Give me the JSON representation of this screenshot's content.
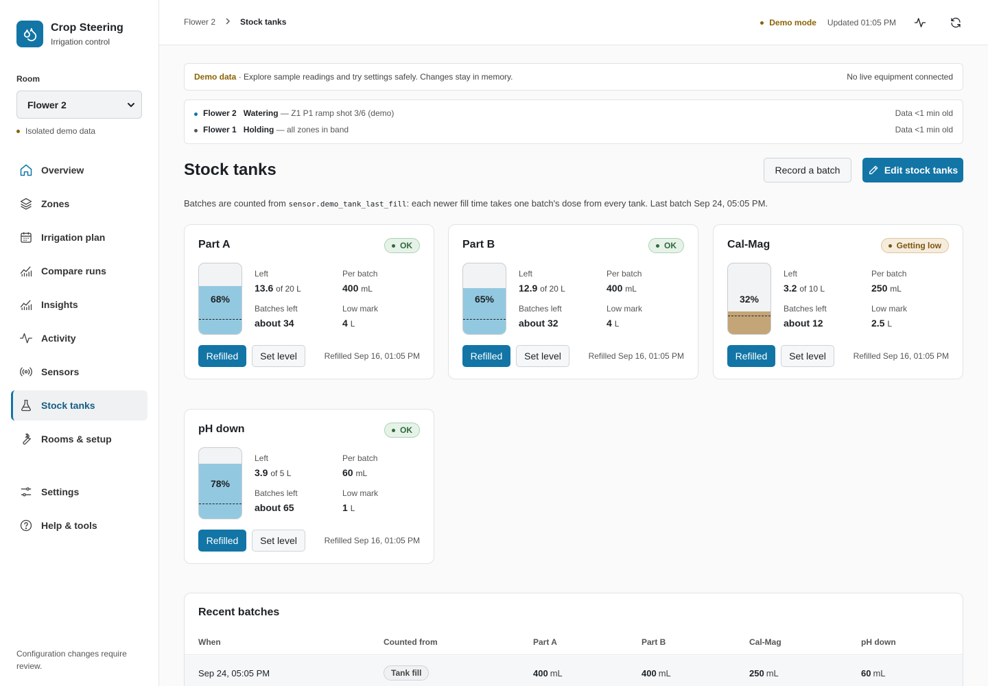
{
  "app": {
    "title": "Crop Steering",
    "subtitle": "Irrigation control"
  },
  "sidebar": {
    "room_label": "Room",
    "room_value": "Flower 2",
    "demo_note": "Isolated demo data",
    "items": [
      {
        "label": "Overview",
        "icon": "home-icon"
      },
      {
        "label": "Zones",
        "icon": "layers-icon"
      },
      {
        "label": "Irrigation plan",
        "icon": "calendar-icon"
      },
      {
        "label": "Compare runs",
        "icon": "chart-icon"
      },
      {
        "label": "Insights",
        "icon": "chart-icon"
      },
      {
        "label": "Activity",
        "icon": "pulse-icon"
      },
      {
        "label": "Sensors",
        "icon": "signal-icon"
      },
      {
        "label": "Stock tanks",
        "icon": "flask-icon"
      },
      {
        "label": "Rooms & setup",
        "icon": "wrench-icon"
      },
      {
        "label": "Settings",
        "icon": "sliders-icon"
      },
      {
        "label": "Help & tools",
        "icon": "help-icon"
      }
    ],
    "footer": "Configuration changes require review."
  },
  "topbar": {
    "breadcrumb": [
      "Flower 2",
      "Stock tanks"
    ],
    "demo_mode": "Demo mode",
    "updated": "Updated 01:05 PM"
  },
  "banner": {
    "bold": "Demo data",
    "text": " · Explore sample readings and try settings safely. Changes stay in memory.",
    "right": "No live equipment connected"
  },
  "status": [
    {
      "room": "Flower 2",
      "state": "Watering",
      "detail": " — Z1 P1 ramp shot 3/6 (demo)",
      "age": "Data <1 min old",
      "color": "#1275a6"
    },
    {
      "room": "Flower 1",
      "state": "Holding",
      "detail": " — all zones in band",
      "age": "Data <1 min old",
      "color": "#555555"
    }
  ],
  "page": {
    "title": "Stock tanks",
    "record_label": "Record a batch",
    "edit_label": "Edit stock tanks",
    "desc_pre": "Batches are counted from ",
    "desc_code": "sensor.demo_tank_last_fill",
    "desc_post": ": each newer fill time takes one batch's dose from every tank. Last batch Sep 24, 05:05 PM."
  },
  "labels": {
    "left": "Left",
    "per_batch": "Per batch",
    "batches_left": "Batches left",
    "low_mark": "Low mark",
    "refilled_btn": "Refilled",
    "set_level_btn": "Set level"
  },
  "tanks": [
    {
      "name": "Part A",
      "status": "OK",
      "pct_label": "68%",
      "fill": 0.68,
      "low": 0.2,
      "left": "13.6",
      "cap": "of 20 L",
      "per_batch": "400",
      "per_unit": "mL",
      "batches_left": "about 34",
      "low_mark": "4",
      "low_unit": "L",
      "refilled": "Refilled Sep 16, 01:05 PM",
      "fill_color": "#93c9e0"
    },
    {
      "name": "Part B",
      "status": "OK",
      "pct_label": "65%",
      "fill": 0.65,
      "low": 0.2,
      "left": "12.9",
      "cap": "of 20 L",
      "per_batch": "400",
      "per_unit": "mL",
      "batches_left": "about 32",
      "low_mark": "4",
      "low_unit": "L",
      "refilled": "Refilled Sep 16, 01:05 PM",
      "fill_color": "#93c9e0"
    },
    {
      "name": "Cal-Mag",
      "status": "Getting low",
      "pct_label": "32%",
      "fill": 0.32,
      "low": 0.25,
      "left": "3.2",
      "cap": "of 10 L",
      "per_batch": "250",
      "per_unit": "mL",
      "batches_left": "about 12",
      "low_mark": "2.5",
      "low_unit": "L",
      "refilled": "Refilled Sep 16, 01:05 PM",
      "fill_color": "#c4a577"
    },
    {
      "name": "pH down",
      "status": "OK",
      "pct_label": "78%",
      "fill": 0.78,
      "low": 0.2,
      "left": "3.9",
      "cap": "of 5 L",
      "per_batch": "60",
      "per_unit": "mL",
      "batches_left": "about 65",
      "low_mark": "1",
      "low_unit": "L",
      "refilled": "Refilled Sep 16, 01:05 PM",
      "fill_color": "#93c9e0"
    }
  ],
  "recent": {
    "title": "Recent batches",
    "columns": [
      "When",
      "Counted from",
      "Part A",
      "Part B",
      "Cal-Mag",
      "pH down"
    ],
    "rows": [
      {
        "when": "Sep 24, 05:05 PM",
        "from": "Tank fill",
        "a": "400",
        "b": "400",
        "c": "250",
        "d": "60",
        "unit": "mL"
      }
    ]
  },
  "colors": {
    "accent": "#1275a6",
    "demo": "#8a6304",
    "ok": "#2d6b3a",
    "low": "#7a5510"
  }
}
